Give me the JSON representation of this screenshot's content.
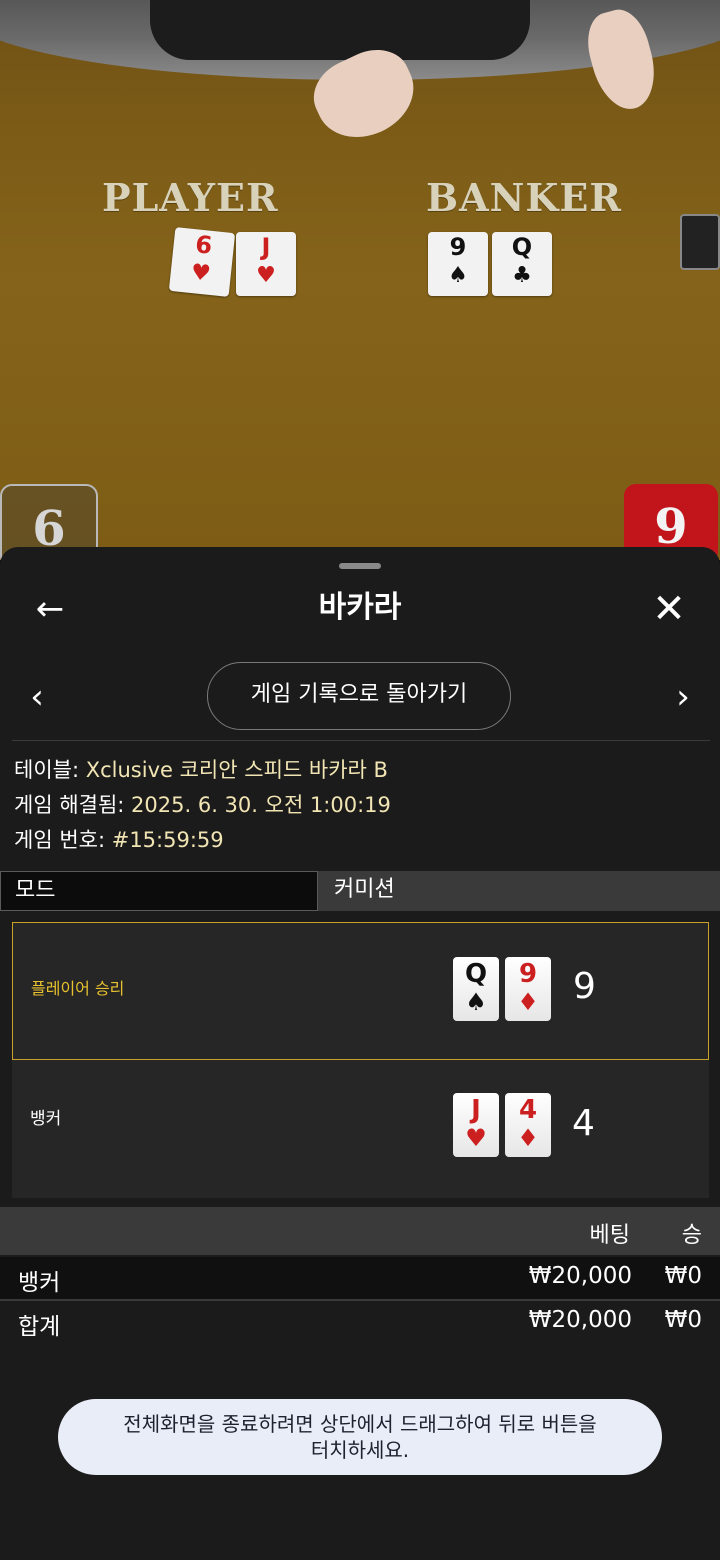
{
  "video": {
    "player_label": "PLAYER",
    "banker_label": "BANKER",
    "player_cards": [
      {
        "rank": "6",
        "suit": "♥",
        "color": "red"
      },
      {
        "rank": "J",
        "suit": "♥",
        "color": "red"
      }
    ],
    "banker_cards": [
      {
        "rank": "9",
        "suit": "♠",
        "color": "black"
      },
      {
        "rank": "Q",
        "suit": "♣",
        "color": "black"
      }
    ],
    "player_score": "6",
    "banker_score": "9"
  },
  "sheet": {
    "title": "바카라",
    "back_icon": "←",
    "close_icon": "✕",
    "prev_icon": "‹",
    "next_icon": "›",
    "history_button": "게임 기록으로 돌아가기"
  },
  "info": {
    "table_label": "테이블:",
    "table_value": "Xclusive 코리안 스피드 바카라 B",
    "resolved_label": "게임 해결됨:",
    "resolved_value": "2025. 6. 30. 오전 1:00:19",
    "number_label": "게임 번호:",
    "number_value": "#15:59:59"
  },
  "mode": {
    "label": "모드",
    "value": "커미션"
  },
  "results": {
    "player": {
      "label": "플레이어 승리",
      "cards": [
        {
          "rank": "Q",
          "suit": "♠",
          "color": "black"
        },
        {
          "rank": "9",
          "suit": "♦",
          "color": "red"
        }
      ],
      "score": "9"
    },
    "banker": {
      "label": "뱅커",
      "cards": [
        {
          "rank": "J",
          "suit": "♥",
          "color": "red"
        },
        {
          "rank": "4",
          "suit": "♦",
          "color": "red"
        }
      ],
      "score": "4"
    }
  },
  "bets_table": {
    "headers": {
      "bet": "베팅",
      "win": "승"
    },
    "rows": [
      {
        "label": "뱅커",
        "bet": "₩20,000",
        "win": "₩0"
      }
    ],
    "total": {
      "label": "합계",
      "bet": "₩20,000",
      "win": "₩0"
    }
  },
  "toast": {
    "line1": "전체화면을 종료하려면 상단에서 드래그하여 뒤로 버튼을",
    "line2": "터치하세요."
  },
  "colors": {
    "accent_gold": "#c9a227",
    "banker_red": "#c2151b",
    "sheet_bg": "#1b1b1b"
  }
}
